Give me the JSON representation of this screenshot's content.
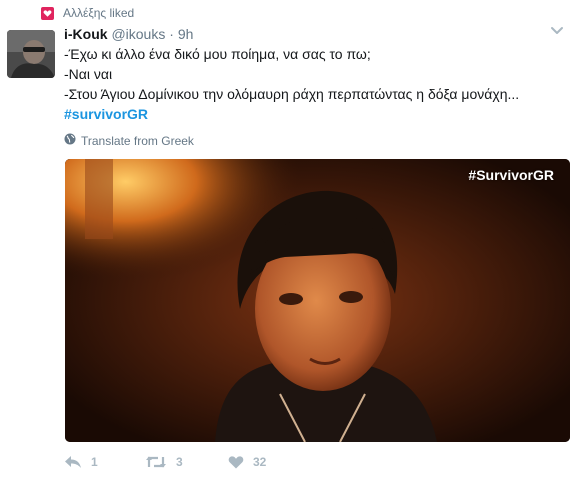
{
  "context": {
    "liked_by": "Αλλέξης liked"
  },
  "tweet": {
    "fullname": "i-Kouk",
    "handle": "@ikouks",
    "separator": "·",
    "time": "9h",
    "lines": [
      "-Έχω κι άλλο ένα δικό μου ποίημα, να σας το πω;",
      "-Ναι ναι",
      "-Στου Άγιου Δομίνικου την ολόμαυρη ράχη περπατώντας η δόξα μονάχη..."
    ],
    "hashtag": "#survivorGR",
    "translate_label": "Translate from Greek",
    "media_watermark": "#SurvivorGR"
  },
  "actions": {
    "reply_count": "1",
    "retweet_count": "3",
    "like_count": "32"
  },
  "colors": {
    "like_badge": "#e0245e",
    "hashtag": "#1b95e0",
    "meta_gray": "#657786",
    "action_gray": "#aab8c2"
  },
  "icons": [
    "heart-icon",
    "chevron-down-icon",
    "globe-icon",
    "reply-icon",
    "retweet-icon",
    "like-icon"
  ]
}
